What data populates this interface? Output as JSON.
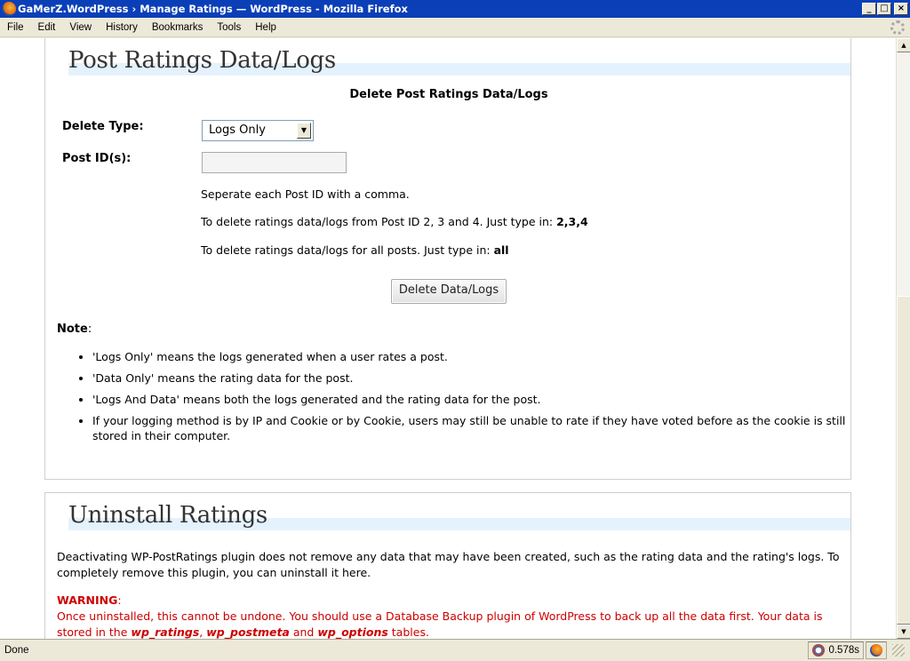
{
  "window": {
    "title": "GaMerZ.WordPress › Manage Ratings — WordPress - Mozilla Firefox",
    "min_label": "_",
    "max_label": "□",
    "close_label": "×"
  },
  "menu": {
    "items": [
      "File",
      "Edit",
      "View",
      "History",
      "Bookmarks",
      "Tools",
      "Help"
    ]
  },
  "section1": {
    "heading": "Post Ratings Data/Logs",
    "subtitle": "Delete Post Ratings Data/Logs",
    "delete_type_label": "Delete Type:",
    "delete_type_value": "Logs Only",
    "post_ids_label": "Post ID(s):",
    "post_ids_value": "",
    "help1": "Seperate each Post ID with a comma.",
    "help2_prefix": "To delete ratings data/logs from Post ID 2, 3 and 4. Just type in: ",
    "help2_example": "2,3,4",
    "help3_prefix": "To delete ratings data/logs for all posts. Just type in: ",
    "help3_example": "all",
    "button_label": "Delete Data/Logs",
    "note_label": "Note",
    "note_colon": ":",
    "notes": [
      "'Logs Only' means the logs generated when a user rates a post.",
      "'Data Only' means the rating data for the post.",
      "'Logs And Data' means both the logs generated and the rating data for the post.",
      "If your logging method is by IP and Cookie or by Cookie, users may still be unable to rate if they have voted before as the cookie is still stored in their computer."
    ]
  },
  "section2": {
    "heading": "Uninstall Ratings",
    "paragraph": "Deactivating WP-PostRatings plugin does not remove any data that may have been created, such as the rating data and the rating's logs. To completely remove this plugin, you can uninstall it here.",
    "warning_label": "WARNING",
    "warning_colon": ":",
    "warning_text": "Once uninstalled, this cannot be undone. You should use a Database Backup plugin of WordPress to back up all the data first. Your data is stored in the ",
    "table1": "wp_ratings",
    "sep1": ", ",
    "table2": "wp_postmeta",
    "sep2": " and ",
    "table3": "wp_options",
    "warning_end": " tables."
  },
  "status": {
    "text": "Done",
    "timer": "0.578s"
  }
}
